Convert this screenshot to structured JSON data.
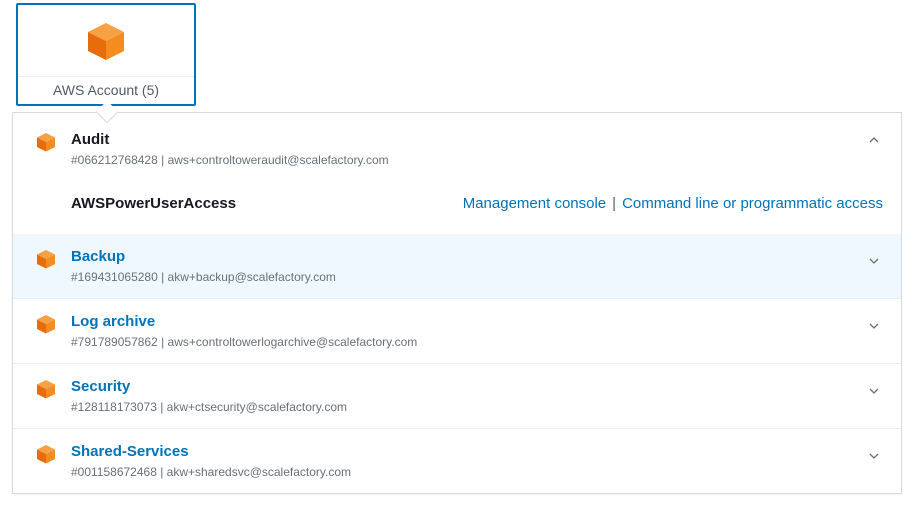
{
  "tab": {
    "label": "AWS Account (5)"
  },
  "expanded": {
    "name": "Audit",
    "id_prefix": "#066212768428",
    "email": "aws+controltoweraudit@scalefactory.com",
    "role": {
      "name": "AWSPowerUserAccess",
      "console_link": "Management console",
      "cli_link": "Command line or programmatic access"
    }
  },
  "accounts": [
    {
      "name": "Backup",
      "id_prefix": "#169431065280",
      "email": "akw+backup@scalefactory.com",
      "highlight": true
    },
    {
      "name": "Log archive",
      "id_prefix": "#791789057862",
      "email": "aws+controltowerlogarchive@scalefactory.com",
      "highlight": false
    },
    {
      "name": "Security",
      "id_prefix": "#128118173073",
      "email": "akw+ctsecurity@scalefactory.com",
      "highlight": false
    },
    {
      "name": "Shared-Services",
      "id_prefix": "#001158672468",
      "email": "akw+sharedsvc@scalefactory.com",
      "highlight": false
    }
  ]
}
